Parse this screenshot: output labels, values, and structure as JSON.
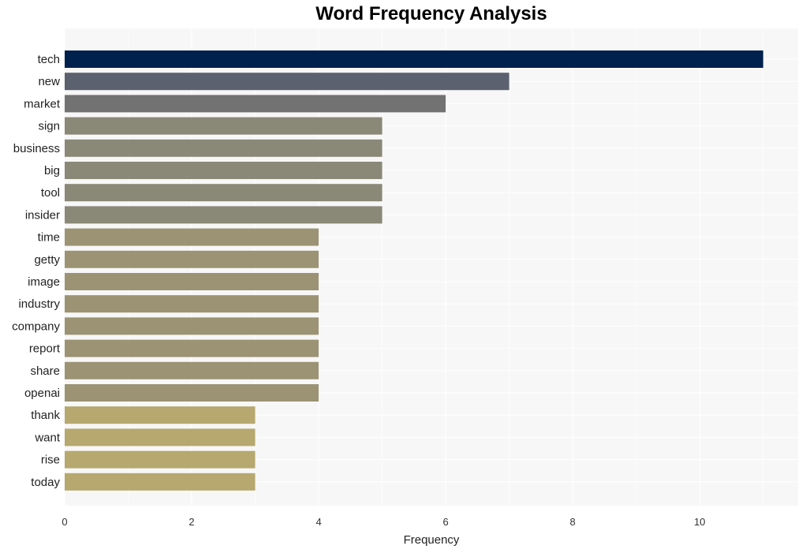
{
  "chart_data": {
    "type": "bar",
    "orientation": "horizontal",
    "title": "Word Frequency Analysis",
    "xlabel": "Frequency",
    "ylabel": "",
    "xlim": [
      0,
      11.55
    ],
    "xticks": [
      0,
      2,
      4,
      6,
      8,
      10
    ],
    "grid": true,
    "legend": "none",
    "categories": [
      "tech",
      "new",
      "market",
      "sign",
      "business",
      "big",
      "tool",
      "insider",
      "time",
      "getty",
      "image",
      "industry",
      "company",
      "report",
      "share",
      "openai",
      "thank",
      "want",
      "rise",
      "today"
    ],
    "values": [
      11,
      7,
      6,
      5,
      5,
      5,
      5,
      5,
      4,
      4,
      4,
      4,
      4,
      4,
      4,
      4,
      3,
      3,
      3,
      3
    ],
    "colors": [
      "#00204e",
      "#5c6170",
      "#727272",
      "#8a8877",
      "#8a8877",
      "#8a8877",
      "#8a8877",
      "#8a8877",
      "#9c9374",
      "#9c9374",
      "#9c9374",
      "#9c9374",
      "#9c9374",
      "#9c9374",
      "#9c9374",
      "#9c9374",
      "#b6a86e",
      "#b6a86e",
      "#b6a86e",
      "#b6a86e"
    ]
  },
  "style": {
    "plot_bg": "#f7f7f7",
    "grid_color": "#ffffff"
  }
}
